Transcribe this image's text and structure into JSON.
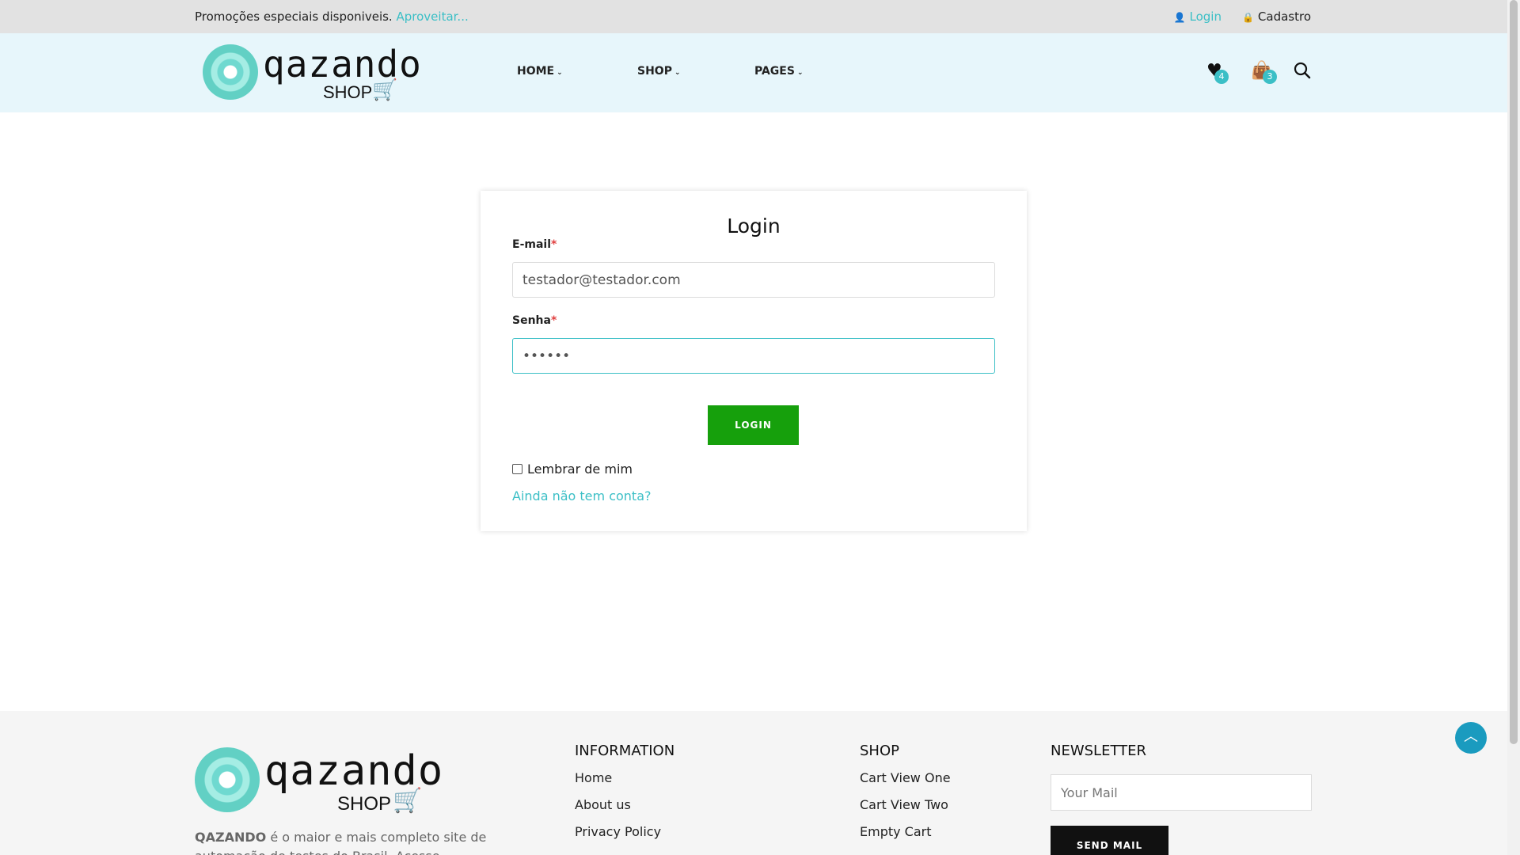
{
  "topbar": {
    "promo_text": "Promoções especiais disponiveis.",
    "promo_link": "Aproveitar...",
    "login_link": "Login",
    "cadastro_link": "Cadastro"
  },
  "header": {
    "logo_text": "qazando",
    "logo_shop": "SHOP",
    "nav": [
      "HOME",
      "SHOP",
      "PAGES"
    ],
    "wishlist_count": "4",
    "cart_count": "3"
  },
  "login_form": {
    "title": "Login",
    "email_label": "E-mail",
    "email_value": "testador@testador.com",
    "password_label": "Senha",
    "password_value": "••••••",
    "required_mark": "*",
    "submit_label": "LOGIN",
    "remember_label": "Lembrar de mim",
    "signup_link": "Ainda não tem conta?"
  },
  "footer": {
    "brand": "QAZANDO",
    "description": "é o maior e mais completo site de automação de testes do Brasil. Acesse...",
    "information": {
      "title": "INFORMATION",
      "links": [
        "Home",
        "About us",
        "Privacy Policy"
      ]
    },
    "shop": {
      "title": "SHOP",
      "links": [
        "Cart View One",
        "Cart View Two",
        "Empty Cart"
      ]
    },
    "newsletter": {
      "title": "NEWSLETTER",
      "placeholder": "Your Mail",
      "button": "SEND MAIL"
    }
  },
  "colors": {
    "accent": "#3bbfc6",
    "login_button": "#16a00c",
    "header_bg": "#e7f6fb",
    "topbar_bg": "#e2e2e2"
  }
}
